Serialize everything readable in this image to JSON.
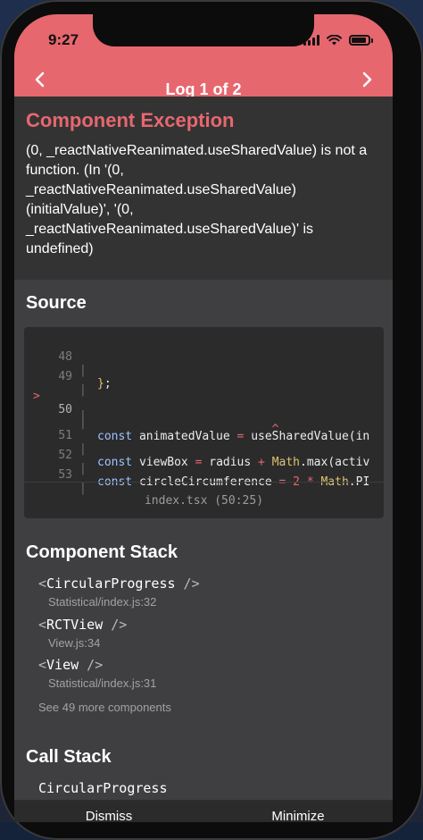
{
  "status_bar": {
    "time": "9:27"
  },
  "header": {
    "title": "Log 1 of 2",
    "prev_icon": "chevron-left-icon",
    "next_icon": "chevron-right-icon",
    "accent_color": "#e7676f"
  },
  "exception": {
    "title": "Component Exception",
    "message_lines": [
      "(0, _reactNativeReanimated.useSharedValue) is not a",
      "function. (In '(0,",
      "_reactNativeReanimated.useSharedValue)",
      "(initialValue)', '(0,",
      "_reactNativeReanimated.useSharedValue)' is",
      "undefined)"
    ]
  },
  "source": {
    "title": "Source",
    "lines": [
      {
        "num": "48",
        "marker": "",
        "text": "};"
      },
      {
        "num": "49",
        "marker": "",
        "text": ""
      },
      {
        "num": "50",
        "marker": ">",
        "text": "const animatedValue = useSharedValue(in"
      },
      {
        "num": "",
        "marker": "",
        "text": "                         ^"
      },
      {
        "num": "51",
        "marker": "",
        "text": "const viewBox = radius + Math.max(activ"
      },
      {
        "num": "52",
        "marker": "",
        "text": "const circleCircumference = 2 * Math.PI"
      },
      {
        "num": "53",
        "marker": "",
        "text": ""
      }
    ],
    "file_ref": "index.tsx (50:25)"
  },
  "component_stack": {
    "title": "Component Stack",
    "items": [
      {
        "name": "CircularProgress",
        "location": "Statistical/index.js:32"
      },
      {
        "name": "RCTView",
        "location": "View.js:34"
      },
      {
        "name": "View",
        "location": "Statistical/index.js:31"
      }
    ],
    "more": "See 49 more components"
  },
  "call_stack": {
    "title": "Call Stack",
    "items": [
      "CircularProgress"
    ]
  },
  "actions": {
    "dismiss": "Dismiss",
    "minimize": "Minimize"
  }
}
